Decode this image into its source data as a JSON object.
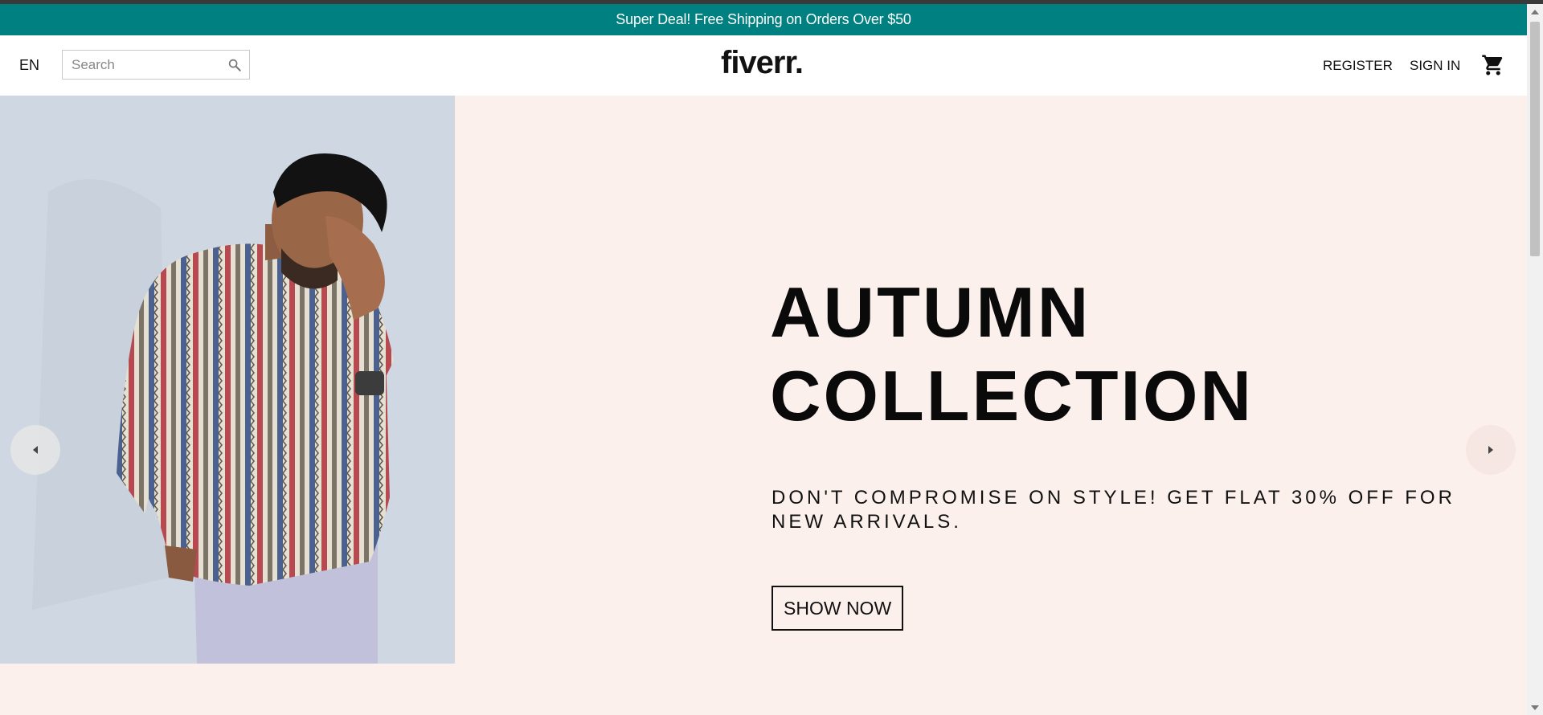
{
  "announcement": {
    "text": "Super Deal! Free Shipping on Orders Over $50"
  },
  "header": {
    "language": "EN",
    "search": {
      "placeholder": "Search",
      "value": ""
    },
    "logo": "fiverr.",
    "links": {
      "register": "REGISTER",
      "sign_in": "SIGN IN"
    },
    "cart_icon": "shopping-cart-icon"
  },
  "hero": {
    "title_line1": "AUTUMN",
    "title_line2": "COLLECTION",
    "description": "DON'T COMPROMISE ON STYLE! GET FLAT 30% OFF FOR NEW ARRIVALS.",
    "button_label": "SHOW NOW",
    "arrows": {
      "left_icon": "arrow-left-icon",
      "right_icon": "arrow-right-icon"
    }
  },
  "colors": {
    "announcement_bg": "#008080",
    "hero_bg": "#fcf0ec",
    "text": "#0a0a0a"
  }
}
